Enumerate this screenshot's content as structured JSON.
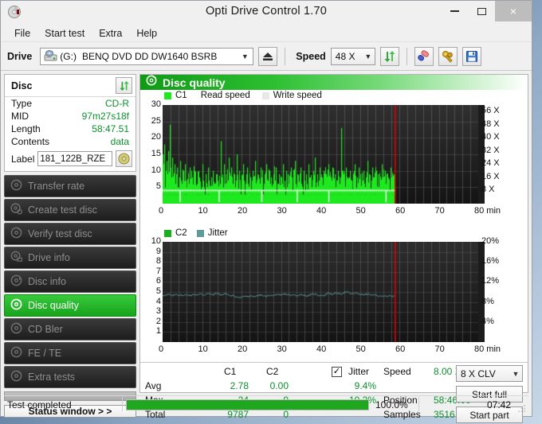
{
  "window": {
    "title": "Opti Drive Control 1.70",
    "app_icon": "disc-icon",
    "minimize": "minimize-icon",
    "maximize": "maximize-icon",
    "close": "×"
  },
  "menu": [
    "File",
    "Start test",
    "Extra",
    "Help"
  ],
  "toolbar": {
    "drive_label": "Drive",
    "drive_letter": "(G:)",
    "drive_name": "BENQ DVD DD DW1640 BSRB",
    "eject": "eject-icon",
    "speed_label": "Speed",
    "speed_value": "48 X",
    "refresh": "refresh-icon",
    "erase": "erase-icon",
    "tools": "tools-icon",
    "save": "save-icon",
    "caret": "⌄"
  },
  "disc_panel": {
    "header": "Disc",
    "refresh_icon": "refresh-icon",
    "rows": [
      {
        "key": "Type",
        "value": "CD-R"
      },
      {
        "key": "MID",
        "value": "97m27s18f"
      },
      {
        "key": "Length",
        "value": "58:47.51"
      },
      {
        "key": "Contents",
        "value": "data"
      }
    ],
    "label_key": "Label",
    "label_value": "181_122B_RZE",
    "label_icon": "cd-icon"
  },
  "nav": {
    "items": [
      {
        "label": "Transfer rate",
        "icon": "disc-icon",
        "active": false
      },
      {
        "label": "Create test disc",
        "icon": "disc-write-icon",
        "active": false
      },
      {
        "label": "Verify test disc",
        "icon": "disc-check-icon",
        "active": false
      },
      {
        "label": "Drive info",
        "icon": "drive-icon",
        "active": false
      },
      {
        "label": "Disc info",
        "icon": "disc-info-icon",
        "active": false
      },
      {
        "label": "Disc quality",
        "icon": "disc-quality-icon",
        "active": true
      },
      {
        "label": "CD Bler",
        "icon": "disc-icon",
        "active": false
      },
      {
        "label": "FE / TE",
        "icon": "disc-icon",
        "active": false
      },
      {
        "label": "Extra tests",
        "icon": "disc-icon",
        "active": false
      }
    ],
    "status_window_button": "Status window > >"
  },
  "quality": {
    "header_title": "Disc quality",
    "header_icon": "disc-quality-icon"
  },
  "stats": {
    "col_c1": "C1",
    "col_c2": "C2",
    "jitter_label": "Jitter",
    "jitter_checked": true,
    "rows": [
      {
        "name": "Avg",
        "c1": "2.78",
        "c2": "0.00",
        "jitter": "9.4%"
      },
      {
        "name": "Max",
        "c1": "24",
        "c2": "0",
        "jitter": "10.3%"
      },
      {
        "name": "Total",
        "c1": "9787",
        "c2": "0",
        "jitter": ""
      }
    ],
    "speed_key": "Speed",
    "speed_value": "8.00 X",
    "position_key": "Position",
    "position_value": "58:46.00",
    "samples_key": "Samples",
    "samples_value": "3516",
    "clv_value": "8 X CLV",
    "start_full": "Start full",
    "start_part": "Start part"
  },
  "statusbar": {
    "text": "Test completed",
    "progress_pct": "100.0%",
    "progress_value": 100,
    "elapsed": "07:42"
  },
  "colors": {
    "c1_green": "#1ee81e",
    "jitter_teal": "#5d9a9a",
    "read_speed_white": "#ffffff",
    "marker_red": "#e00000",
    "accent_green": "#0c8f2e",
    "plot_bg": "#1c1c1c"
  },
  "chart_data": [
    {
      "type": "bar",
      "id": "c1-chart",
      "title": "",
      "xlabel": "min",
      "ylabel": "",
      "xlim": [
        0,
        80
      ],
      "ylim": [
        0,
        30
      ],
      "xticks": [
        0,
        10,
        20,
        30,
        40,
        50,
        60,
        70,
        80
      ],
      "xtick_labels": [
        "0",
        "10",
        "20",
        "30",
        "40",
        "50",
        "60",
        "70",
        "80 min"
      ],
      "yticks": [
        5,
        10,
        15,
        20,
        25,
        30
      ],
      "ytick_labels": [
        "5",
        "10",
        "15",
        "20",
        "25",
        "30"
      ],
      "y2lim": [
        0,
        60
      ],
      "y2ticks": [
        8,
        16,
        24,
        32,
        40,
        48,
        56
      ],
      "y2tick_labels": [
        "8 X",
        "16 X",
        "24 X",
        "32 X",
        "40 X",
        "48 X",
        "56 X"
      ],
      "legend": [
        {
          "name": "C1",
          "color": "#1ee81e"
        },
        {
          "name": "Read speed",
          "color": "#ffffff"
        },
        {
          "name": "Write speed",
          "color": "#e8e8e8"
        }
      ],
      "legend_position": "top-left",
      "grid": true,
      "data_end_min": 58.8,
      "marker_min": 58.8,
      "series": [
        {
          "name": "C1",
          "type": "bar",
          "color": "#1ee81e",
          "x_start": 0,
          "x_end": 58.8,
          "baseline": 2.78,
          "values": [
            15,
            12,
            18,
            10,
            13,
            9,
            16,
            24,
            11,
            8,
            14,
            7,
            12,
            6,
            9,
            11,
            5,
            8,
            13,
            7,
            6,
            10,
            5,
            12,
            7,
            4,
            9,
            6,
            11,
            5,
            8,
            4,
            7,
            10,
            6,
            5,
            9,
            4,
            8,
            6,
            5,
            12,
            7,
            4,
            9,
            6,
            5,
            11,
            7,
            4,
            8,
            5,
            10,
            6,
            4,
            9,
            5,
            7,
            4,
            6,
            19,
            8,
            5,
            12,
            6,
            9,
            4,
            7,
            14,
            5,
            8,
            11,
            6,
            4,
            9,
            5,
            15,
            7,
            4,
            10,
            6,
            8,
            5,
            12,
            7,
            4,
            9,
            11,
            6,
            5,
            8,
            4,
            7,
            10,
            5,
            13,
            6,
            4,
            9,
            7,
            5,
            11,
            8,
            4,
            6,
            9,
            5,
            12,
            7,
            4,
            10,
            6,
            8,
            5,
            9,
            4,
            7,
            11,
            6,
            5,
            9,
            4,
            8,
            6,
            12,
            5,
            7,
            10,
            4,
            9,
            6,
            5,
            11,
            8,
            4,
            7,
            13,
            6,
            5,
            9,
            4,
            8,
            11,
            6,
            5,
            10,
            7,
            4,
            9,
            6,
            12,
            5,
            8,
            4,
            7,
            10,
            6,
            14,
            5,
            9,
            4,
            7,
            11,
            6,
            8,
            5,
            10,
            4,
            9,
            7,
            6,
            12,
            5,
            8,
            4,
            11,
            6,
            9,
            5,
            7,
            4,
            10,
            6,
            8,
            23,
            5,
            9,
            7,
            4,
            11,
            6,
            8,
            5,
            10,
            4,
            7,
            9,
            6,
            12,
            5,
            8,
            4,
            11,
            6,
            9,
            5,
            7,
            10,
            4,
            8,
            6,
            13,
            5,
            9,
            4,
            7,
            11,
            6,
            8,
            5,
            10,
            4,
            9,
            6,
            7,
            5,
            12,
            8,
            4,
            10,
            6,
            9,
            5,
            7,
            4,
            11,
            8,
            6,
            9,
            5
          ]
        },
        {
          "name": "Read speed",
          "type": "line",
          "color": "#ffffff",
          "x_start": 0,
          "x_end": 58.8,
          "constant_x": 8.0,
          "note": "flat line at 8X CLV with brief dips"
        }
      ]
    },
    {
      "type": "line",
      "id": "c2-jitter-chart",
      "title": "",
      "xlabel": "min",
      "ylabel": "",
      "xlim": [
        0,
        80
      ],
      "ylim": [
        0,
        10
      ],
      "xticks": [
        0,
        10,
        20,
        30,
        40,
        50,
        60,
        70,
        80
      ],
      "xtick_labels": [
        "0",
        "10",
        "20",
        "30",
        "40",
        "50",
        "60",
        "70",
        "80 min"
      ],
      "yticks": [
        1,
        2,
        3,
        4,
        5,
        6,
        7,
        8,
        9,
        10
      ],
      "ytick_labels": [
        "1",
        "2",
        "3",
        "4",
        "5",
        "6",
        "7",
        "8",
        "9",
        "10"
      ],
      "y2lim": [
        0,
        20
      ],
      "y2ticks": [
        4,
        8,
        12,
        16,
        20
      ],
      "y2tick_labels": [
        "4%",
        "8%",
        "12%",
        "16%",
        "20%"
      ],
      "legend": [
        {
          "name": "C2",
          "color": "#19b019"
        },
        {
          "name": "Jitter",
          "color": "#5d9a9a"
        }
      ],
      "legend_position": "top-left",
      "grid": true,
      "data_end_min": 58.8,
      "marker_min": 58.8,
      "series": [
        {
          "name": "C2",
          "type": "bar",
          "color": "#19b019",
          "values_all_zero": true
        },
        {
          "name": "Jitter",
          "type": "line",
          "color": "#5d9a9a",
          "x_start": 0,
          "x_end": 58.8,
          "avg_percent": 9.4,
          "max_percent": 10.3,
          "values": [
            4.7,
            4.65,
            4.7,
            4.75,
            4.6,
            4.7,
            4.8,
            4.65,
            4.7,
            4.6,
            4.75,
            4.7,
            4.6,
            4.8,
            4.7,
            4.65,
            4.9,
            4.75,
            4.7,
            4.8,
            4.85,
            4.7,
            4.75,
            4.9,
            4.8,
            4.7,
            4.75,
            4.85,
            4.7,
            4.6,
            4.65,
            4.5,
            4.55,
            4.45,
            4.5,
            4.6,
            4.55,
            4.5,
            4.6,
            4.55,
            4.6,
            4.65,
            4.7,
            4.6,
            4.55,
            4.65,
            4.7,
            4.6,
            4.75,
            4.7,
            4.65,
            4.7,
            4.8,
            4.75,
            4.7,
            4.65,
            4.7,
            4.6,
            4.7,
            4.75,
            4.7,
            4.65,
            4.6,
            4.7,
            4.75,
            4.8,
            4.7,
            4.65,
            4.7,
            4.6,
            4.85,
            4.9,
            4.8,
            4.75,
            4.9,
            4.85,
            4.8,
            4.9,
            5.0,
            4.95,
            4.85,
            4.8,
            4.9,
            4.85,
            4.8,
            4.75,
            4.7,
            4.8,
            4.75,
            4.7,
            4.65,
            4.7,
            4.6,
            4.55,
            4.6,
            4.65,
            4.55,
            4.6,
            4.5,
            4.6
          ]
        }
      ]
    }
  ]
}
